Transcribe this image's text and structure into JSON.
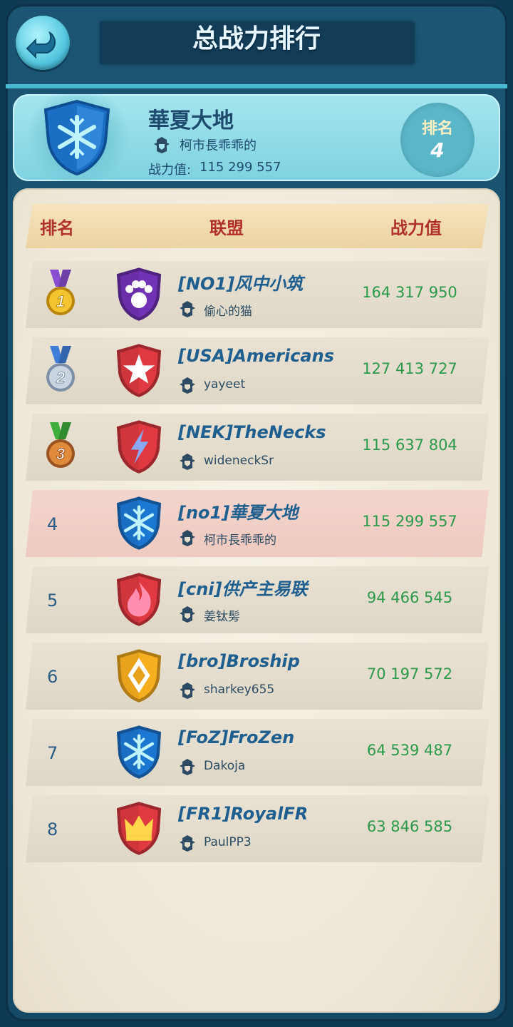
{
  "header": {
    "title": "总战力排行"
  },
  "summary": {
    "name": "華夏大地",
    "leader": "柯市長乖乖的",
    "power_label": "战力值:",
    "power": "115 299 557",
    "rank_label": "排名",
    "rank_value": "4",
    "emblem": "snowflake-icon"
  },
  "table": {
    "col_rank": "排名",
    "col_alliance": "联盟",
    "col_power": "战力值",
    "rows": [
      {
        "rank": "1",
        "medal": "gold-medal-icon",
        "name": "[NO1]风中小筑",
        "leader": "偷心的猫",
        "power": "164 317 950",
        "emblem": "paw-icon",
        "color": "#6a2ea8"
      },
      {
        "rank": "2",
        "medal": "silver-medal-icon",
        "name": "[USA]Americans",
        "leader": "yayeet",
        "power": "127 413 727",
        "emblem": "star-icon",
        "color": "#d0353c"
      },
      {
        "rank": "3",
        "medal": "bronze-medal-icon",
        "name": "[NEK]TheNecks",
        "leader": "wideneckSr",
        "power": "115 637 804",
        "emblem": "lightning-icon",
        "color": "#d0353c"
      },
      {
        "rank": "4",
        "name": "[no1]華夏大地",
        "leader": "柯市長乖乖的",
        "power": "115 299 557",
        "emblem": "snowflake-icon",
        "color": "#1a6fc4",
        "highlight": true
      },
      {
        "rank": "5",
        "name": "[cni]供产主易联",
        "leader": "姜钛髣",
        "power": "94 466 545",
        "emblem": "flame-icon",
        "color": "#d0353c"
      },
      {
        "rank": "6",
        "name": "[bro]Broship",
        "leader": "sharkey655",
        "power": "70 197 572",
        "emblem": "diamond-icon",
        "color": "#e8a21c"
      },
      {
        "rank": "7",
        "name": "[FoZ]FroZen",
        "leader": "Dakoja",
        "power": "64 539 487",
        "emblem": "snowflake-icon",
        "color": "#1a6fc4"
      },
      {
        "rank": "8",
        "name": "[FR1]RoyalFR",
        "leader": "PaulPP3",
        "power": "63 846 585",
        "emblem": "crown-icon",
        "color": "#d0353c"
      }
    ]
  },
  "colors": {
    "power_green": "#2b9a4a",
    "header_red": "#b0322a",
    "name_blue": "#1f5f8f"
  }
}
